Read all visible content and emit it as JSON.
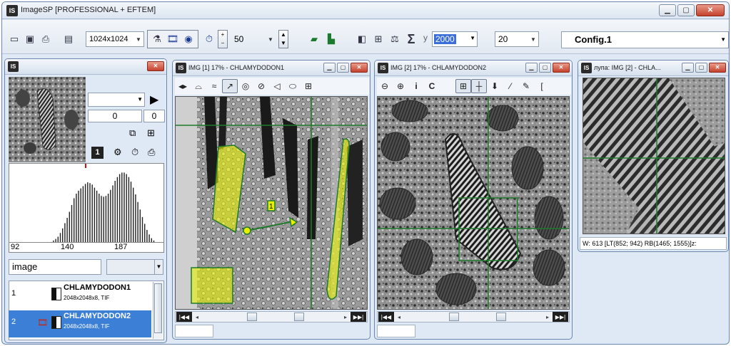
{
  "app": {
    "title": "ImageSP [PROFESSIONAL + EFTEM]"
  },
  "toolbar": {
    "resolution": "1024x1024",
    "spin_value": "50",
    "y_label": "y",
    "y_value": "2000",
    "field_value": "20",
    "config": "Config.1",
    "sigma": "Σ"
  },
  "left_panel": {
    "combo_value": "",
    "counter_a": "0",
    "counter_b": "0",
    "channel_badge": "1",
    "histogram": {
      "tick_labels": [
        "92",
        "140",
        "187"
      ],
      "bars": [
        2,
        4,
        6,
        9,
        14,
        20,
        27,
        34,
        42,
        51,
        60,
        66,
        70,
        73,
        76,
        79,
        81,
        80,
        78,
        74,
        70,
        66,
        63,
        62,
        63,
        66,
        71,
        77,
        83,
        88,
        92,
        94,
        94,
        92,
        88,
        82,
        74,
        65,
        55,
        45,
        35,
        26,
        18,
        12,
        7,
        4
      ]
    },
    "name_input": "image",
    "images": [
      {
        "num": "1",
        "name": "CHLAMYDODON1",
        "meta": "2048x2048x8, TIF"
      },
      {
        "num": "2",
        "name": "CHLAMYDODON2",
        "meta": "2048x2048x8, TIF"
      }
    ]
  },
  "win1": {
    "title": "IMG [1] 17% - CHLAMYDODON1",
    "badge": "1"
  },
  "win2": {
    "title": "IMG [2] 17% - CHLAMYDODON2",
    "tool_i": "i",
    "tool_c": "C"
  },
  "win3": {
    "title": "лупа: IMG [2] - CHLA...",
    "status": "W: 613 [LT(852; 942) RB(1465; 1555)]z:"
  },
  "colors": {
    "accent": "#3c7fd6",
    "selection_yellow": "#e6f000",
    "crosshair_green": "#1f7a2a"
  },
  "icons": [
    "open-icon",
    "save-icon",
    "print-icon",
    "monitor-icon",
    "microscope-icon",
    "film-icon",
    "camera-icon",
    "stopwatch-icon",
    "plus-icon",
    "minus-icon",
    "layer-icon",
    "image-icon",
    "split-icon",
    "grid-icon",
    "balance-icon",
    "sigma-icon",
    "play-icon",
    "cursor-icon",
    "lasso-icon",
    "line-icon",
    "point-icon",
    "circle-icon",
    "zoom-in-icon",
    "zoom-out-icon"
  ]
}
